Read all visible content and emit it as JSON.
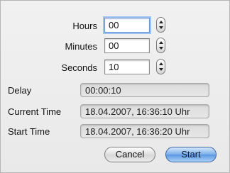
{
  "timer": {
    "hours_label": "Hours",
    "hours_value": "00",
    "minutes_label": "Minutes",
    "minutes_value": "00",
    "seconds_label": "Seconds",
    "seconds_value": "10"
  },
  "info": {
    "delay_label": "Delay",
    "delay_value": "00:00:10",
    "current_time_label": "Current Time",
    "current_time_value": "18.04.2007, 16:36:10 Uhr",
    "start_time_label": "Start Time",
    "start_time_value": "18.04.2007, 16:36:20 Uhr"
  },
  "buttons": {
    "cancel_label": "Cancel",
    "start_label": "Start"
  },
  "icons": {
    "stepper": "up-down-stepper-icon"
  },
  "colors": {
    "default_button": "#5b98e2",
    "focus_ring": "#9ec2f2"
  }
}
